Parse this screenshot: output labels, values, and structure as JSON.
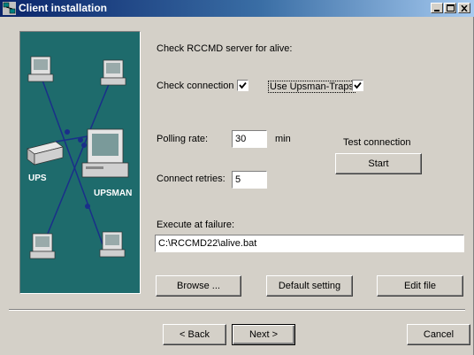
{
  "window": {
    "title": "Client installation"
  },
  "diagram": {
    "ups_label": "UPS",
    "upsman_label": "UPSMAN"
  },
  "form": {
    "heading": "Check RCCMD server for alive:",
    "check_connection_label": "Check connection",
    "check_connection_checked": true,
    "upsman_traps_label": "Use Upsman-Traps",
    "upsman_traps_checked": true,
    "polling_rate_label": "Polling rate:",
    "polling_rate_value": "30",
    "polling_rate_unit": "min",
    "connect_retries_label": "Connect retries:",
    "connect_retries_value": "5",
    "test_connection_label": "Test connection",
    "start_button": "Start",
    "execute_label": "Execute at failure:",
    "execute_value": "C:\\RCCMD22\\alive.bat",
    "browse_button": "Browse ...",
    "default_button": "Default setting",
    "edit_button": "Edit file"
  },
  "footer": {
    "back_button": "< Back",
    "next_button": "Next >",
    "cancel_button": "Cancel"
  }
}
